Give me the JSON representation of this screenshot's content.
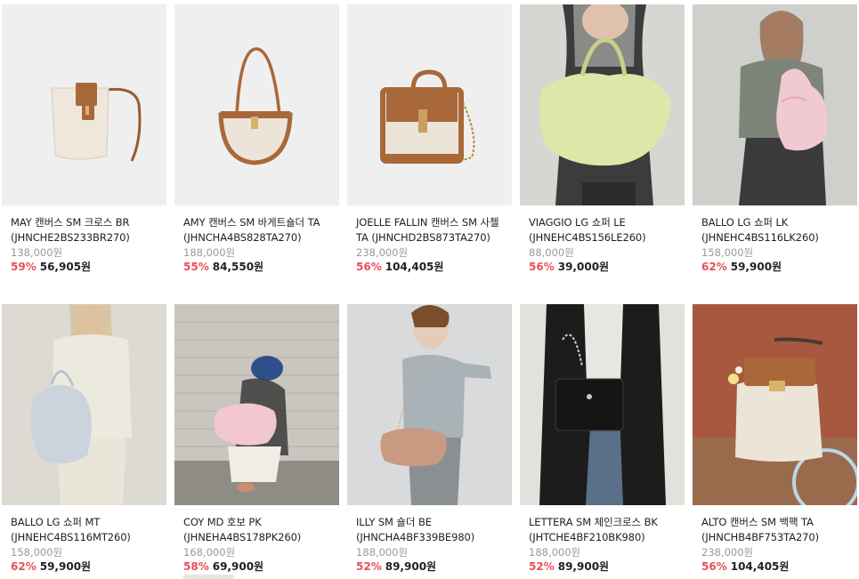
{
  "products": [
    {
      "name": "MAY 캔버스 SM 크로스 BR (JHNCHE2BS233BR270)",
      "original_price": "138,000원",
      "discount": "59%",
      "sale_price": "56,905원",
      "image": "bag-photo"
    },
    {
      "name": "AMY 캔버스 SM 바게트숄더 TA (JHNCHA4BS828TA270)",
      "original_price": "188,000원",
      "discount": "55%",
      "sale_price": "84,550원",
      "image": "bag-photo"
    },
    {
      "name": "JOELLE FALLIN 캔버스 SM 사첼 TA (JHNCHD2BS873TA270)",
      "original_price": "238,000원",
      "discount": "56%",
      "sale_price": "104,405원",
      "image": "bag-photo"
    },
    {
      "name": "VIAGGIO LG 쇼퍼 LE (JHNEHC4BS156LE260)",
      "original_price": "88,000원",
      "discount": "56%",
      "sale_price": "39,000원",
      "image": "model-photo"
    },
    {
      "name": "BALLO LG 쇼퍼 LK (JHNEHC4BS116LK260)",
      "original_price": "158,000원",
      "discount": "62%",
      "sale_price": "59,900원",
      "image": "model-photo"
    },
    {
      "name": "BALLO LG 쇼퍼 MT (JHNEHC4BS116MT260)",
      "original_price": "158,000원",
      "discount": "62%",
      "sale_price": "59,900원",
      "image": "model-photo"
    },
    {
      "name": "COY MD 호보 PK (JHNEHA4BS178PK260)",
      "original_price": "168,000원",
      "discount": "58%",
      "sale_price": "69,900원",
      "image": "model-photo"
    },
    {
      "name": "ILLY SM 숄더 BE (JHNCHA4BF339BE980)",
      "original_price": "188,000원",
      "discount": "52%",
      "sale_price": "89,900원",
      "image": "model-photo"
    },
    {
      "name": "LETTERA SM 체인크로스 BK (JHTCHE4BF210BK980)",
      "original_price": "188,000원",
      "discount": "52%",
      "sale_price": "89,900원",
      "image": "model-photo"
    },
    {
      "name": "ALTO 캔버스 SM 백팩 TA (JHNCHB4BF753TA270)",
      "original_price": "238,000원",
      "discount": "56%",
      "sale_price": "104,405원",
      "image": "bag-photo"
    }
  ],
  "colors": {
    "discount": "#e8505b",
    "original_price": "#999999",
    "text": "#222222",
    "tan": "#a9683a",
    "canvas": "#ece4d8"
  }
}
